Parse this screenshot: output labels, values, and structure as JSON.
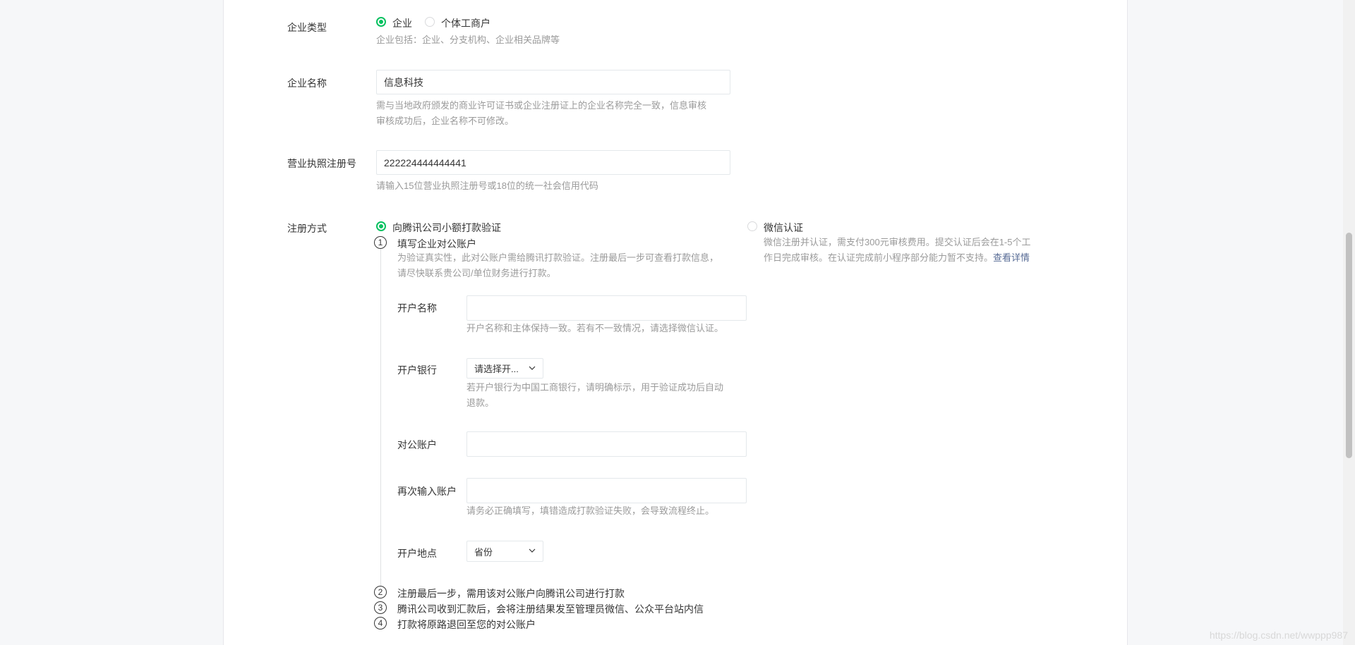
{
  "company_type": {
    "label": "企业类型",
    "options": [
      "企业",
      "个体工商户"
    ],
    "selected": "企业",
    "tip": "企业包括：企业、分支机构、企业相关品牌等"
  },
  "company_name": {
    "label": "企业名称",
    "value": "信息科技",
    "tip_line1": "需与当地政府颁发的商业许可证书或企业注册证上的企业名称完全一致，信息审核",
    "tip_line2": "审核成功后，企业名称不可修改。"
  },
  "license": {
    "label": "营业执照注册号",
    "value": "222224444444441",
    "tip": "请输入15位营业执照注册号或18位的统一社会信用代码"
  },
  "registration": {
    "label": "注册方式",
    "option_transfer": "向腾讯公司小额打款验证",
    "option_wechat": "微信认证",
    "selected": "向腾讯公司小额打款验证",
    "wechat_tip_line1": "微信注册并认证，需支付300元审核费用。提交认证后会在1-5个工",
    "wechat_tip_line2": "作日完成审核。在认证完成前小程序部分能力暂不支持。",
    "wechat_link": "查看详情",
    "steps": [
      {
        "num": "1",
        "title": "填写企业对公账户"
      },
      {
        "num": "2",
        "title": "注册最后一步，需用该对公账户向腾讯公司进行打款"
      },
      {
        "num": "3",
        "title": "腾讯公司收到汇款后，会将注册结果发至管理员微信、公众平台站内信"
      },
      {
        "num": "4",
        "title": "打款将原路退回至您的对公账户"
      }
    ],
    "step1_tip_line1": "为验证真实性，此对公账户需给腾讯打款验证。注册最后一步可查看打款信息，",
    "step1_tip_line2": "请尽快联系贵公司/单位财务进行打款。"
  },
  "account_form": {
    "account_name": {
      "label": "开户名称",
      "value": "",
      "tip": "开户名称和主体保持一致。若有不一致情况，请选择微信认证。"
    },
    "bank": {
      "label": "开户银行",
      "value": "请选择开...",
      "tip_line1": "若开户银行为中国工商银行，请明确标示，用于验证成功后自动",
      "tip_line2": "退款。"
    },
    "account": {
      "label": "对公账户",
      "value": ""
    },
    "account_confirm": {
      "label": "再次输入账户",
      "value": "",
      "tip": "请务必正确填写，填错造成打款验证失败，会导致流程终止。"
    },
    "location": {
      "label": "开户地点",
      "value": "省份"
    }
  },
  "watermark": "https://blog.csdn.net/wwppp987",
  "colors": {
    "accent": "#07c160",
    "link": "#576b95",
    "tip": "#9a9a9a"
  }
}
